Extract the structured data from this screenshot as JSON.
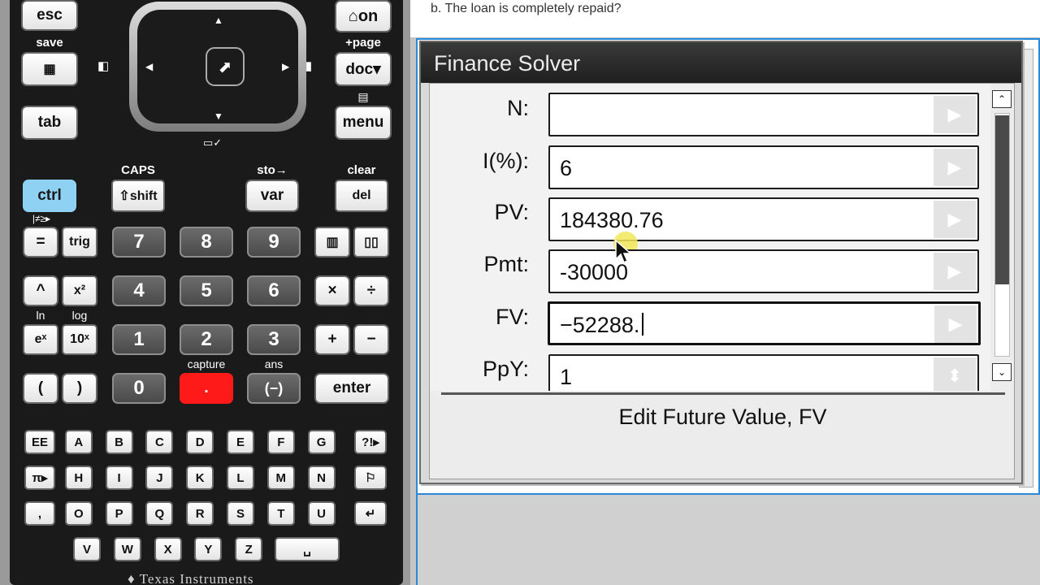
{
  "calculator": {
    "brand": "Texas Instruments",
    "top_keys": {
      "esc": "esc",
      "save": "save",
      "home": "⌂on",
      "page": "+page",
      "doc": "doc▾",
      "tab": "tab",
      "menu": "menu"
    },
    "row_labels": {
      "caps": "CAPS",
      "sto": "sto→",
      "clear": "clear",
      "capture": "capture",
      "ans": "ans",
      "ln": "ln",
      "log": "log"
    },
    "mod_keys": {
      "ctrl": "ctrl",
      "shift": "⇧shift",
      "var": "var",
      "del": "del"
    },
    "func_keys": [
      "=",
      "trig",
      "^",
      "x²",
      "eˣ",
      "10ˣ",
      "(",
      ")",
      "+",
      "−",
      "×",
      "÷",
      "enter",
      "(−)"
    ],
    "digits": [
      "7",
      "8",
      "9",
      "4",
      "5",
      "6",
      "1",
      "2",
      "3",
      "0",
      "."
    ],
    "letters_row1": [
      "EE",
      "A",
      "B",
      "C",
      "D",
      "E",
      "F",
      "G",
      "?!▸"
    ],
    "letters_row2": [
      "π▸",
      "H",
      "I",
      "J",
      "K",
      "L",
      "M",
      "N",
      "⚐"
    ],
    "letters_row3": [
      ",",
      "O",
      "P",
      "Q",
      "R",
      "S",
      "T",
      "U",
      "↵"
    ],
    "letters_row4": [
      "V",
      "W",
      "X",
      "Y",
      "Z",
      "␣"
    ]
  },
  "question": {
    "text": "b. The loan is completely repaid?"
  },
  "dialog": {
    "title": "Finance Solver",
    "fields": [
      {
        "label": "N:",
        "value": ""
      },
      {
        "label": "I(%):",
        "value": "6"
      },
      {
        "label": "PV:",
        "value": "184380.76"
      },
      {
        "label": "Pmt:",
        "value": "-30000"
      },
      {
        "label": "FV:",
        "value": "−52288."
      },
      {
        "label": "PpY:",
        "value": "1"
      }
    ],
    "status": "Edit Future Value, FV"
  },
  "colors": {
    "ctrl_key": "#8fd1f2",
    "capture_key": "#ff1a1a",
    "title_bar": "#2a2a2a",
    "frame_blue": "#2a8ad8",
    "highlight": "#f2e85a"
  }
}
